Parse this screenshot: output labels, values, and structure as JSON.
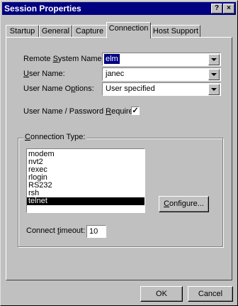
{
  "window": {
    "title": "Session Properties",
    "help_label": "?",
    "close_label": "×"
  },
  "tabs": [
    {
      "label": "Startup"
    },
    {
      "label": "General"
    },
    {
      "label": "Capture"
    },
    {
      "label": "Connection"
    },
    {
      "label": "Host Support"
    }
  ],
  "active_tab": "Connection",
  "form": {
    "remote_system_name": {
      "label_pre": "Remote ",
      "label_u": "S",
      "label_post": "ystem Name:",
      "value": "elm"
    },
    "user_name": {
      "label_u": "U",
      "label_post": "ser Name:",
      "value": "janec"
    },
    "user_name_options": {
      "label_pre": "User Name O",
      "label_u": "p",
      "label_post": "tions:",
      "value": "User specified"
    },
    "password_required": {
      "label_pre": "User Name / Password ",
      "label_u": "R",
      "label_post": "equired:",
      "checked": true,
      "check_mark": "✓"
    }
  },
  "connection_type": {
    "title_u": "C",
    "title_post": "onnection Type:",
    "items": [
      "modem",
      "nvt2",
      "rexec",
      "rlogin",
      "RS232",
      "rsh",
      "telnet"
    ],
    "selected": "telnet",
    "configure_pre": "",
    "configure_u": "C",
    "configure_post": "onfigure..."
  },
  "timeout": {
    "label_pre": "Connect ",
    "label_u": "t",
    "label_post": "imeout:",
    "value": "10"
  },
  "buttons": {
    "ok": "OK",
    "cancel": "Cancel"
  }
}
